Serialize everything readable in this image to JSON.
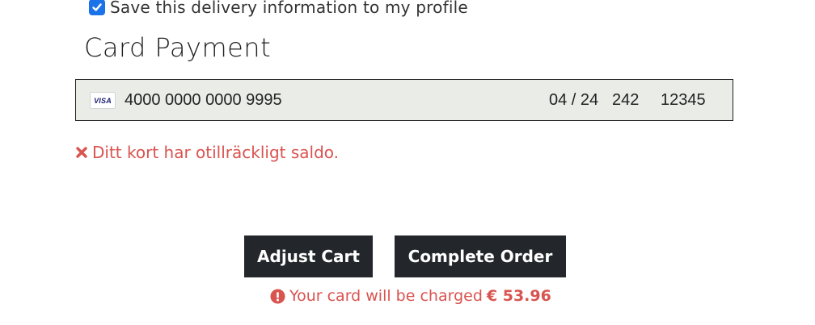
{
  "delivery": {
    "save_checked": true,
    "save_label": "Save this delivery information to my profile"
  },
  "payment": {
    "title": "Card Payment",
    "card_brand": "VISA",
    "card_number": "4000 0000 0000 9995",
    "expiry": "04 / 24",
    "cvc": "242",
    "zip": "12345",
    "error_message": "Ditt kort har otillräckligt saldo."
  },
  "actions": {
    "adjust_cart_label": "Adjust Cart",
    "complete_order_label": "Complete Order"
  },
  "charge_notice": {
    "text": "Your card will be charged",
    "amount": "€ 53.96"
  },
  "icons": {
    "checkbox": "checkmark-icon",
    "error": "close-x-icon",
    "notice": "exclamation-circle-icon"
  },
  "colors": {
    "checkbox": "#1a73e8",
    "error": "#d9534f",
    "button_bg": "#23272b",
    "card_field_bg": "#e9ece7"
  }
}
